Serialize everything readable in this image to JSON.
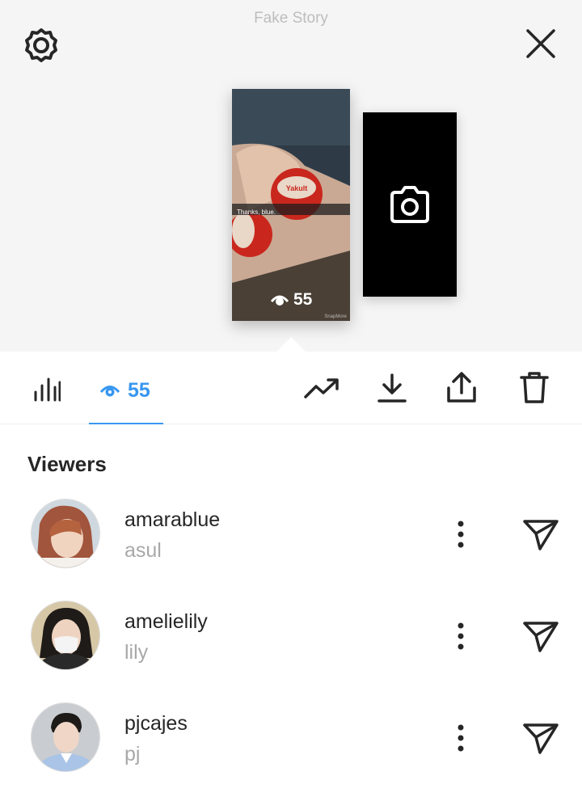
{
  "header": {
    "title": "Fake Story",
    "settings_icon": "gear-icon",
    "close_icon": "close-icon"
  },
  "story": {
    "caption": "Thanks, blue.",
    "views": "55",
    "watermark": "SnapMore",
    "add_icon": "camera-icon"
  },
  "toolbar": {
    "insights_icon": "bar-chart-icon",
    "viewers_count": "55",
    "viewers_icon": "eye-icon",
    "actions": [
      "trending-icon",
      "download-icon",
      "share-icon",
      "trash-icon"
    ],
    "accent_color": "#3897f0"
  },
  "viewers": {
    "heading": "Viewers",
    "items": [
      {
        "username": "amarablue",
        "name": "asul"
      },
      {
        "username": "amelielily",
        "name": "lily"
      },
      {
        "username": "pjcajes",
        "name": "pj"
      }
    ]
  }
}
